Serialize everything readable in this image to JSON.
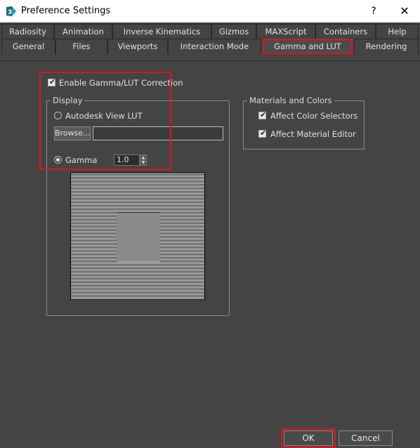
{
  "window": {
    "title": "Preference Settings",
    "help_glyph": "?",
    "close_glyph": "✕"
  },
  "tabs_row1": [
    "Radiosity",
    "Animation",
    "Inverse Kinematics",
    "Gizmos",
    "MAXScript",
    "Containers",
    "Help"
  ],
  "tabs_row2": [
    "General",
    "Files",
    "Viewports",
    "Interaction Mode",
    "Gamma and LUT",
    "Rendering"
  ],
  "active_tab": "Gamma and LUT",
  "gamma": {
    "enable_label": "Enable Gamma/LUT Correction",
    "enable_checked": true,
    "display": {
      "title": "Display",
      "lut_label": "Autodesk View LUT",
      "browse_label": "Browse...",
      "path_value": "",
      "gamma_label": "Gamma",
      "gamma_value": "1.0",
      "selected": "Gamma"
    }
  },
  "materials": {
    "title": "Materials and Colors",
    "items": [
      {
        "label": "Affect Color Selectors",
        "checked": true
      },
      {
        "label": "Affect Material Editor",
        "checked": true
      }
    ]
  },
  "footer": {
    "ok_label": "OK",
    "cancel_label": "Cancel"
  },
  "colors": {
    "background": "#444444",
    "highlight": "#e0141a"
  },
  "icons": {
    "app": "3ds-max-app-icon",
    "check": "check-icon"
  }
}
